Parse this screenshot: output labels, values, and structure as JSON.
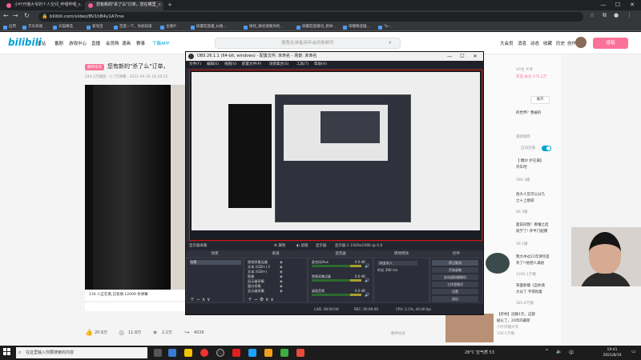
{
  "browser": {
    "tabs": [
      {
        "label": "小叶开播大爷的个人空间_哔哩哔哩_..."
      },
      {
        "label": "您有新的\"杀了么\"订单，您在哪里_..."
      }
    ],
    "url": "bilibili.com/video/BV1hB4y1A7me",
    "bookmarks": [
      "应用",
      "京东商城",
      "天猫精选",
      "爱淘宝",
      "百度一下，你就知道",
      "主图片",
      "搞蘑菇直播_bi搜...",
      "微优_微优搜集你的...",
      "搞蘑菇直播间_抓林...",
      "串糖精选推...",
      "\"b-..."
    ],
    "window_controls": {
      "minimize": "—",
      "maximize": "☐",
      "close": "✕"
    }
  },
  "bili": {
    "logo": "bilibili",
    "nav": [
      "主站",
      "番剧",
      "游戏中心",
      "直播",
      "会员购",
      "漫画",
      "赛事",
      "下载APP"
    ],
    "search_placeholder": "搜我在准备用年会的新邮件",
    "right_nav": [
      "大会员",
      "消息",
      "动态",
      "收藏",
      "历史",
      "创作"
    ],
    "upload": "投稿",
    "video_tag": "稿件投诉",
    "video_title": "您有新的\"杀了么\"订单，",
    "video_meta": "244.2万播放 · 1.7万弹幕 · 2021-04-26 16:18:52",
    "danmaku_info": "116 人正在看,已装填 12009 条弹幕",
    "danmaku_placeholder": "发个友善的弹幕见证当下",
    "danmaku_etiquette": "弹幕礼仪",
    "send": "发送",
    "report": "稿件投诉",
    "actions": [
      {
        "icon": "👍",
        "label": "20.6万"
      },
      {
        "icon": "◎",
        "label": "11.8万"
      },
      {
        "icon": "★",
        "label": "2.2万"
      },
      {
        "icon": "↪",
        "label": "4026"
      }
    ],
    "side": {
      "line1": "UP主 大爷",
      "line2": "充电 关注 475.2万",
      "line3": "的世界？我被的",
      "line4": "遇新推荐",
      "line5": "自动连播",
      "line6": "【 糖炒 炉已满】",
      "line7": "开车吧",
      "line8": "286.3播",
      "line9": "放大人见可以分几",
      "line10": "之十上接碳",
      "line11": "86.3播",
      "line12": "面前同我！看懂之后",
      "line13": "就学了! 开半门超爆",
      "line14": "36.1播",
      "line15": "我大冲过21年清凭是",
      "line16": "有了!!他把人满进",
      "line17": "1296.1万播",
      "line18": "哥面新播《自你滴",
      "line19": "大伙了 不得抱着",
      "line20": "381.6万播",
      "line21": "【开村】冠群1元，这部",
      "line22": "剧火了，20年的最新",
      "line23": "小叶开播大爷",
      "line24": "336.1万播",
      "button": "展开"
    }
  },
  "obs": {
    "title": "OBS 26.1.1 (64-bit, windows) - 配置文件: 未命名 - 场景: 未命名",
    "menu": [
      "文件(F)",
      "编辑(E)",
      "视图(V)",
      "配置文件(P)",
      "场景集合(S)",
      "工具(T)",
      "帮助(H)"
    ],
    "toolbar": [
      "显示器采集",
      "⚙ 属性",
      "◐ 滤镜",
      "显示器",
      "显示器 2 1920x1080 @ 0,0"
    ],
    "docks": {
      "scenes": "场景",
      "sources": "来源",
      "mixer": "混音器",
      "transitions": "转场特效",
      "controls": "控件"
    },
    "scene_items": [
      "场景"
    ],
    "sources_list": [
      "视频采集设备",
      "文本 (GDI+) 2",
      "文本 (GDI+)",
      "图像",
      "显示器采集",
      "窗口采集",
      "显示器采集"
    ],
    "mixer_channels": [
      {
        "name": "麦克风/Aux",
        "db": "0.0 dB"
      },
      {
        "name": "视频采集设备",
        "db": "0.0 dB"
      },
      {
        "name": "桌面音频",
        "db": "0.0 dB"
      }
    ],
    "transition": "淡出淡入",
    "transition_duration": "时长 300 ms",
    "controls": [
      "停止推流",
      "开始录制",
      "启动虚拟摄像机",
      "工作室模式",
      "设置",
      "退出"
    ],
    "status": {
      "live": "LIVE: 00:00:00",
      "rec": "REC: 00:00:00",
      "cpu": "CPU: 2.1%, 40.00 fps"
    }
  },
  "taskbar": {
    "search": "在这里输入你要搜索的内容",
    "weather": "28°C 空气质 53",
    "tray_icons": [
      "^",
      "🔈",
      "中"
    ],
    "time": "19:41",
    "date": "2021/8/19"
  }
}
